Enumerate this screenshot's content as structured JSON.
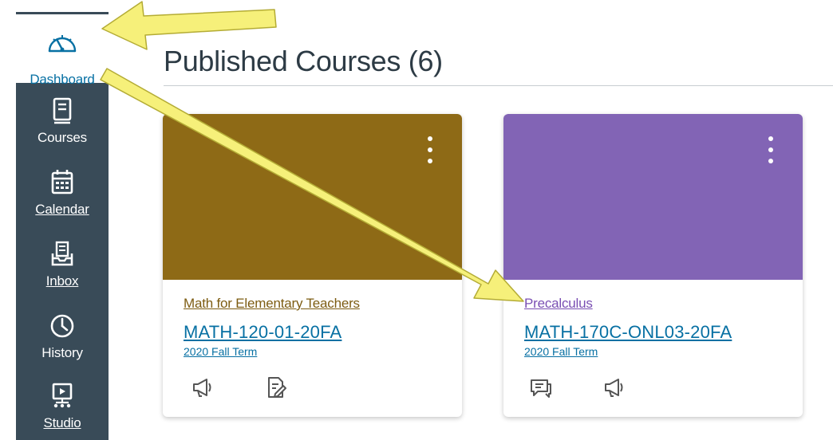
{
  "nav": {
    "items": [
      {
        "label": "Dashboard",
        "icon": "dashboard-icon"
      },
      {
        "label": "Courses",
        "icon": "courses-icon"
      },
      {
        "label": "Calendar",
        "icon": "calendar-icon"
      },
      {
        "label": "Inbox",
        "icon": "inbox-icon"
      },
      {
        "label": "History",
        "icon": "history-icon"
      },
      {
        "label": "Studio",
        "icon": "studio-icon"
      }
    ]
  },
  "header": {
    "title": "Published Courses (6)"
  },
  "cards": [
    {
      "name": "Math for Elementary Teachers",
      "code": "MATH-120-01-20FA",
      "term": "2020 Fall Term",
      "color": "#8e6a16",
      "actions": [
        "announcements-icon",
        "assignments-icon"
      ]
    },
    {
      "name": "Precalculus",
      "code": "MATH-170C-ONL03-20FA",
      "term": "2020 Fall Term",
      "color": "#8264b5",
      "actions": [
        "discussions-icon",
        "announcements-icon"
      ]
    }
  ],
  "colors": {
    "nav_bg": "#394b58",
    "link": "#0770a3",
    "annotation_arrow": "#f6f07a"
  }
}
